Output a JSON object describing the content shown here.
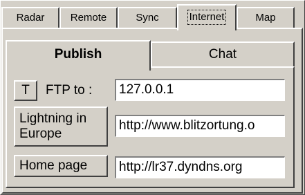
{
  "top_tabs": [
    {
      "label": "Radar"
    },
    {
      "label": "Remote"
    },
    {
      "label": "Sync"
    },
    {
      "label": "Internet"
    },
    {
      "label": "Map"
    }
  ],
  "sub_tabs": [
    {
      "label": "Publish"
    },
    {
      "label": "Chat"
    }
  ],
  "publish": {
    "t_button_label": "T",
    "ftp_label": "FTP to :",
    "ftp_value": "127.0.0.1",
    "lightning_button_label": "Lightning in Europe",
    "lightning_value": "http://www.blitzortung.o",
    "homepage_button_label": "Home page",
    "homepage_value": "http://lr37.dyndns.org"
  }
}
